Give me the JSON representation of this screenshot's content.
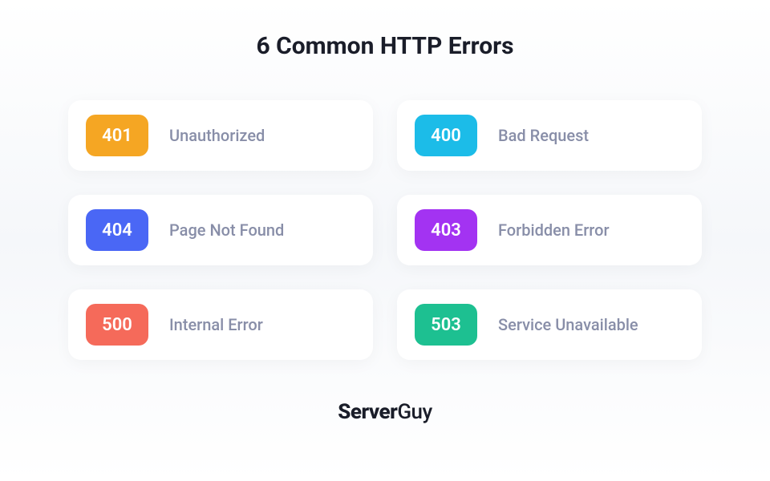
{
  "title": "6 Common HTTP Errors",
  "errors": [
    {
      "code": "401",
      "label": "Unauthorized",
      "color": "#f5a623"
    },
    {
      "code": "400",
      "label": "Bad Request",
      "color": "#1cbce8"
    },
    {
      "code": "404",
      "label": "Page Not Found",
      "color": "#4a67f5"
    },
    {
      "code": "403",
      "label": "Forbidden Error",
      "color": "#a333f2"
    },
    {
      "code": "500",
      "label": "Internal Error",
      "color": "#f56a5a"
    },
    {
      "code": "503",
      "label": "Service Unavailable",
      "color": "#1dc091"
    }
  ],
  "brand": {
    "part1": "Server",
    "part2": "Guy"
  }
}
